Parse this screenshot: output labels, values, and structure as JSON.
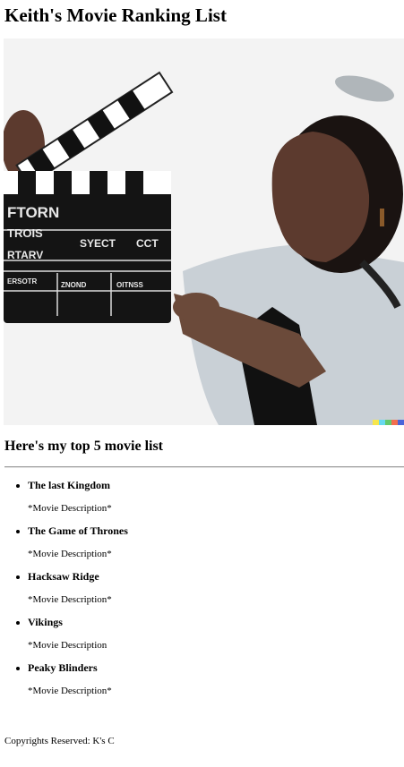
{
  "page": {
    "title": "Keith's Movie Ranking List"
  },
  "hero_image": {
    "description_icon": "clapperboard-image",
    "clapper_text": [
      "FTORN",
      "TROIS",
      "SYECT",
      "CCT",
      "RTARV",
      "ERSOTR",
      "ZNOND",
      "OITNSS"
    ]
  },
  "section": {
    "heading": "Here's my top 5 movie list"
  },
  "movies": [
    {
      "title": "The last Kingdom",
      "description": "*Movie Description*"
    },
    {
      "title": "The Game of Thrones",
      "description": "*Movie Description*"
    },
    {
      "title": "Hacksaw Ridge",
      "description": "*Movie Description*"
    },
    {
      "title": "Vikings",
      "description": "*Movie Description"
    },
    {
      "title": "Peaky Blinders",
      "description": "*Movie Description*"
    }
  ],
  "footer": {
    "text": "Copyrights Reserved: K's C"
  }
}
